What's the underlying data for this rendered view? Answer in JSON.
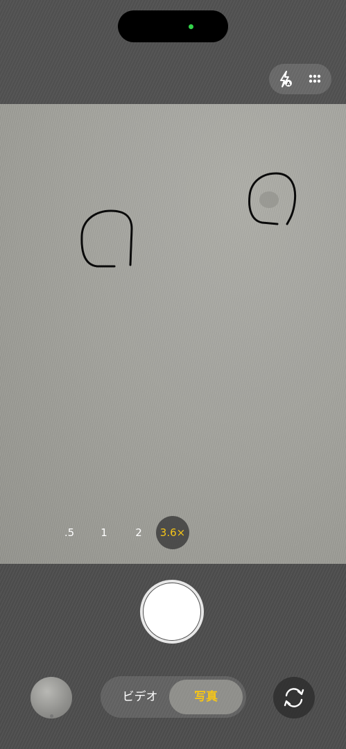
{
  "status": {
    "camera_indicator_color": "#33d24a"
  },
  "top_controls": {
    "flash_icon": "flash-auto-icon",
    "more_icon": "more-dots-icon"
  },
  "zoom": {
    "options": [
      ".5",
      "1",
      "2",
      "3.6×"
    ],
    "selected": "3.6×",
    "selected_color": "#f5c518"
  },
  "modes": {
    "video_label": "ビデオ",
    "photo_label": "写真",
    "selected": "写真"
  },
  "bottom": {
    "thumbnail_icon": "last-photo-thumbnail",
    "flip_icon": "camera-flip-icon"
  }
}
